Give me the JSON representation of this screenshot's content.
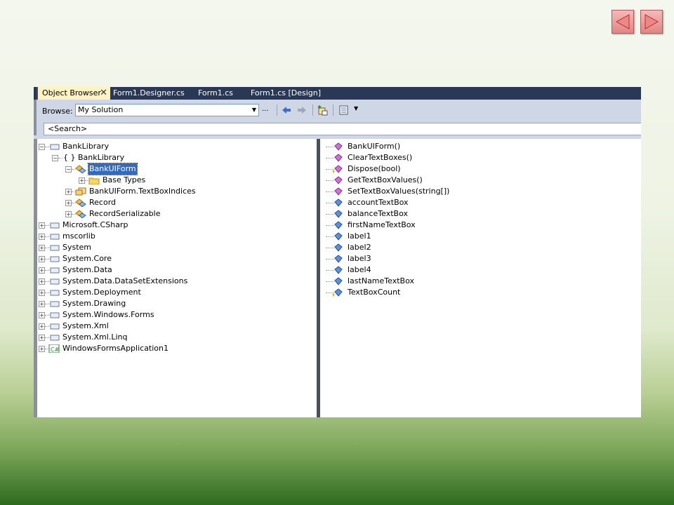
{
  "tabs": [
    {
      "label": "Object Browser",
      "active": true,
      "close": "✕"
    },
    {
      "label": "Form1.Designer.cs"
    },
    {
      "label": "Form1.cs"
    },
    {
      "label": "Form1.cs [Design]"
    }
  ],
  "toolbar": {
    "browse_label": "Browse:",
    "browse_value": "My Solution",
    "customize_label": "...",
    "search_placeholder": "<Search>"
  },
  "tree": [
    {
      "label": "BankLibrary",
      "icon": "assembly-icon",
      "expander": "−"
    },
    {
      "label": "{ } BankLibrary",
      "icon": "namespace-icon",
      "expander": "−"
    },
    {
      "label": "BankUIForm",
      "icon": "class-icon",
      "expander": "−",
      "selected": true
    },
    {
      "label": "Base Types",
      "icon": "folder-icon",
      "expander": "+"
    },
    {
      "label": "BankUIForm.TextBoxIndices",
      "icon": "enum-icon",
      "expander": "+"
    },
    {
      "label": "Record",
      "icon": "class-icon",
      "expander": "+"
    },
    {
      "label": "RecordSerializable",
      "icon": "class-icon",
      "expander": "+"
    },
    {
      "label": "Microsoft.CSharp",
      "icon": "assembly-icon",
      "expander": "+"
    },
    {
      "label": "mscorlib",
      "icon": "assembly-icon",
      "expander": "+"
    },
    {
      "label": "System",
      "icon": "assembly-icon",
      "expander": "+"
    },
    {
      "label": "System.Core",
      "icon": "assembly-icon",
      "expander": "+"
    },
    {
      "label": "System.Data",
      "icon": "assembly-icon",
      "expander": "+"
    },
    {
      "label": "System.Data.DataSetExtensions",
      "icon": "assembly-icon",
      "expander": "+"
    },
    {
      "label": "System.Deployment",
      "icon": "assembly-icon",
      "expander": "+"
    },
    {
      "label": "System.Drawing",
      "icon": "assembly-icon",
      "expander": "+"
    },
    {
      "label": "System.Windows.Forms",
      "icon": "assembly-icon",
      "expander": "+"
    },
    {
      "label": "System.Xml",
      "icon": "assembly-icon",
      "expander": "+"
    },
    {
      "label": "System.Xml.Linq",
      "icon": "assembly-icon",
      "expander": "+"
    },
    {
      "label": "WindowsFormsApplication1",
      "icon": "project-icon",
      "expander": "+"
    }
  ],
  "members": [
    {
      "label": "BankUIForm()",
      "icon": "method-icon"
    },
    {
      "label": "ClearTextBoxes()",
      "icon": "method-icon"
    },
    {
      "label": "Dispose(bool)",
      "icon": "protected-method-icon"
    },
    {
      "label": "GetTextBoxValues()",
      "icon": "method-icon"
    },
    {
      "label": "SetTextBoxValues(string[])",
      "icon": "method-icon"
    },
    {
      "label": "accountTextBox",
      "icon": "field-icon"
    },
    {
      "label": "balanceTextBox",
      "icon": "field-icon"
    },
    {
      "label": "firstNameTextBox",
      "icon": "field-icon"
    },
    {
      "label": "label1",
      "icon": "field-icon"
    },
    {
      "label": "label2",
      "icon": "field-icon"
    },
    {
      "label": "label3",
      "icon": "field-icon"
    },
    {
      "label": "label4",
      "icon": "field-icon"
    },
    {
      "label": "lastNameTextBox",
      "icon": "field-icon"
    },
    {
      "label": "TextBoxCount",
      "icon": "protected-field-icon"
    }
  ],
  "colors": {
    "tab_bar": "#293955",
    "active_tab": "#fff3c2",
    "selection": "#316ac5",
    "method": "#c030c0",
    "field": "#2060d0"
  }
}
